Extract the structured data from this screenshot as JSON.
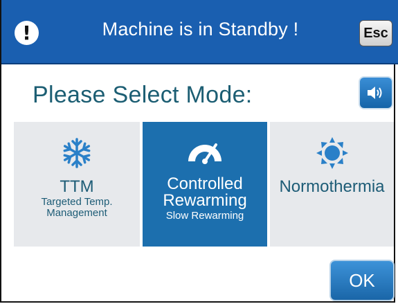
{
  "header": {
    "title": "Machine is in Standby !",
    "esc_label": "Esc",
    "alert_glyph": "!",
    "color": "#1a5fb0"
  },
  "prompt": "Please Select Mode:",
  "modes": [
    {
      "label": "TTM",
      "sub_lines": [
        "Targeted Temp.",
        "Management"
      ],
      "icon": "snowflake-icon",
      "selected": false
    },
    {
      "label_lines": [
        "Controlled",
        "Rewarming"
      ],
      "sub": "Slow Rewarming",
      "icon": "gauge-icon",
      "selected": true
    },
    {
      "label": "Normothermia",
      "icon": "sun-icon",
      "selected": false
    }
  ],
  "ok_label": "OK",
  "colors": {
    "accent": "#1c6fae",
    "tile_bg": "#e7e9ec",
    "text": "#1d5c76"
  }
}
